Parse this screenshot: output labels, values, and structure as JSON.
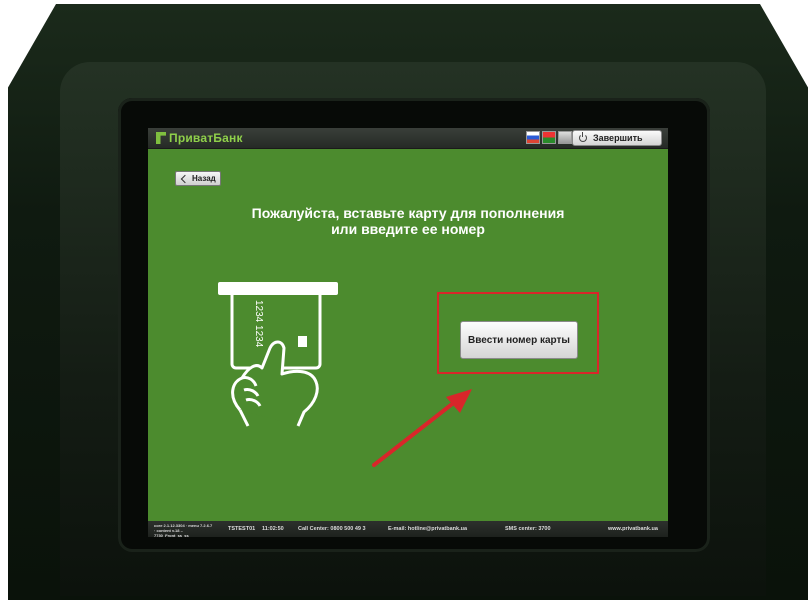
{
  "header": {
    "logo_text": "ПриватБанк",
    "exit_label": "Завершить",
    "languages": [
      "ru-flag",
      "ua-flag",
      "en-flag"
    ]
  },
  "back_label": "Назад",
  "prompt": {
    "line1": "Пожалуйста, вставьте карту для пополнения",
    "line2": "или введите ее номер"
  },
  "card_number_text": "1234 1234",
  "enter_button_label": "Ввести номер карты",
  "footer": {
    "version": "core 2.1.12.3304 · menu 7.2.6.7 · content v.18 – 7730_Front_ss_ss",
    "terminal_id": "TSTEST01",
    "time": "11:02:50",
    "call_center": "Call Center: 0800 500 49 3",
    "email": "E-mail: hotline@privatbank.ua",
    "sms_center": "SMS center: 3700",
    "website": "www.privatbank.ua"
  },
  "colors": {
    "screen_green": "#4c8b2e",
    "annotation_red": "#d9262a",
    "logo_green": "#8fd04a"
  },
  "icons": [
    "power-icon",
    "chevron-left-icon",
    "card-insert-icon",
    "arrow-annotation-icon"
  ]
}
